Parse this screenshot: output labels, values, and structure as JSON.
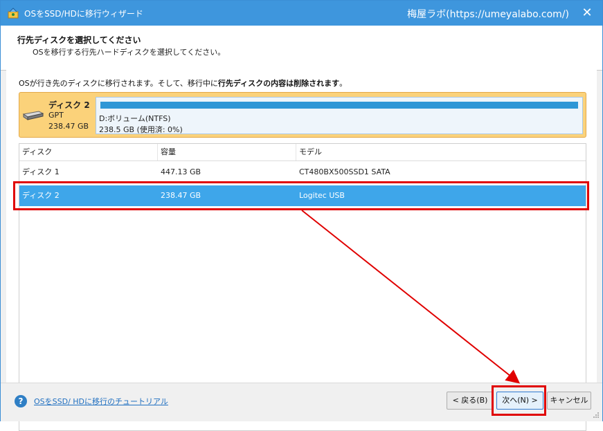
{
  "window": {
    "title": "OSをSSD/HDに移行ウィザード",
    "watermark": "梅屋ラボ(https://umeyalabo.com/)",
    "close_glyph": "✕"
  },
  "header": {
    "title": "行先ディスクを選択してください",
    "subtitle": "OSを移行する行先ハードディスクを選択してください。"
  },
  "notice": {
    "part1": "OSが行き先のディスクに移行されます。そして、移行中に",
    "bold": "行先ディスクの内容は削除されます",
    "part2": "。"
  },
  "selected_disk": {
    "name": "ディスク 2",
    "type": "GPT",
    "size": "238.47 GB",
    "partition_label": "D:ボリューム(NTFS)",
    "partition_usage": "238.5 GB (使用済: 0%)",
    "used_fraction": 0.0
  },
  "table": {
    "columns": [
      "ディスク",
      "容量",
      "モデル"
    ],
    "rows": [
      {
        "disk": "ディスク 1",
        "capacity": "447.13 GB",
        "model": "CT480BX500SSD1 SATA",
        "selected": false
      },
      {
        "disk": "ディスク 2",
        "capacity": "238.47 GB",
        "model": "Logitec  USB",
        "selected": true
      }
    ]
  },
  "footer": {
    "help_glyph": "?",
    "help_link": "OSをSSD/ HDに移行のチュートリアル",
    "back": "< 戻る(B)",
    "next": "次へ(N) >",
    "cancel": "キャンセル"
  },
  "colors": {
    "titlebar": "#3e96dd",
    "selected_row": "#3ea6ea",
    "disk_card": "#fbd27a",
    "annotation": "#e00000"
  }
}
